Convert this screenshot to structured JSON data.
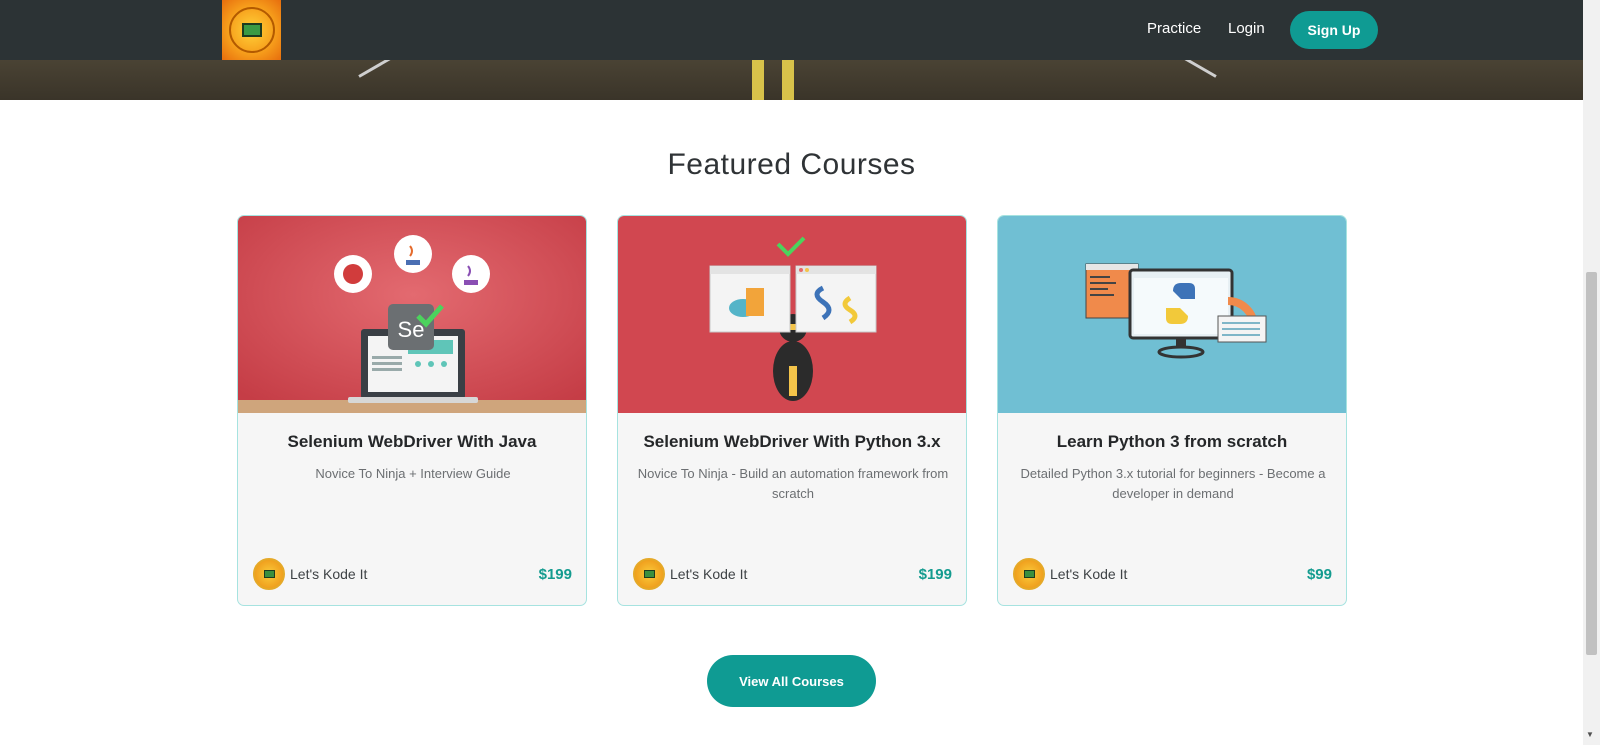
{
  "nav": {
    "links": [
      "Practice",
      "Login"
    ],
    "signup_label": "Sign Up"
  },
  "section": {
    "title": "Featured Courses"
  },
  "courses": [
    {
      "title": "Selenium WebDriver With Java",
      "subtitle": "Novice To Ninja + Interview Guide",
      "author": "Let's Kode It",
      "price": "$199",
      "image_bg": "#d0474f"
    },
    {
      "title": "Selenium WebDriver With Python 3.x",
      "subtitle": "Novice To Ninja - Build an automation framework from scratch",
      "author": "Let's Kode It",
      "price": "$199",
      "image_bg": "#d14750"
    },
    {
      "title": "Learn Python 3 from scratch",
      "subtitle": "Detailed Python 3.x tutorial for beginners - Become a developer in demand",
      "author": "Let's Kode It",
      "price": "$99",
      "image_bg": "#70bfd3"
    }
  ],
  "cta": {
    "view_all_label": "View All Courses"
  },
  "colors": {
    "accent": "#0f9b93",
    "navbar": "#2c3335",
    "price": "#139b8f"
  }
}
